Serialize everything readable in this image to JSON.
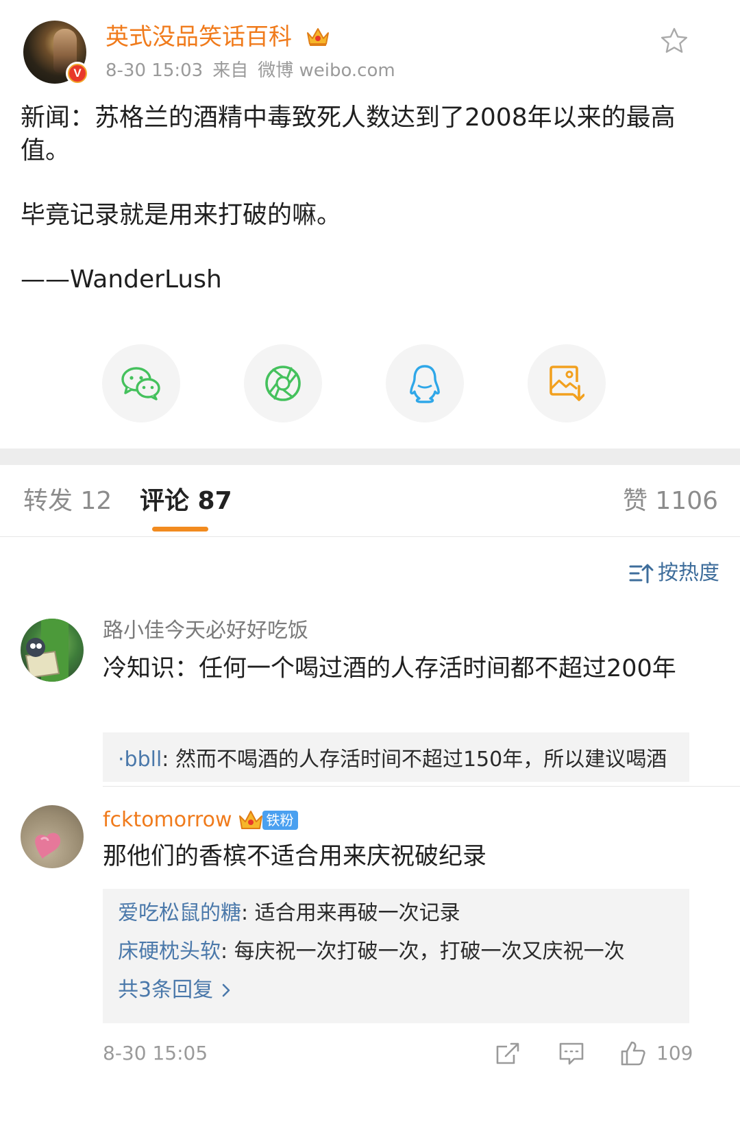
{
  "post": {
    "author": "英式没品笑话百科",
    "time": "8-30 15:03",
    "source_prefix": "来自",
    "source": "微博 weibo.com",
    "paragraphs": [
      "新闻：苏格兰的酒精中毒致死人数达到了2008年以来的最高值。",
      "毕竟记录就是用来打破的嘛。",
      "——WanderLush"
    ]
  },
  "share": {
    "items": [
      {
        "name": "wechat-share-button",
        "icon": "wechat-icon",
        "color": "#45c15d"
      },
      {
        "name": "moments-share-button",
        "icon": "moments-aperture-icon",
        "color": "#45c15d"
      },
      {
        "name": "qq-share-button",
        "icon": "qq-penguin-icon",
        "color": "#2fa7e8"
      },
      {
        "name": "save-image-button",
        "icon": "save-image-icon",
        "color": "#f2a01e"
      }
    ]
  },
  "tabs": {
    "repost": "转发 12",
    "comment": "评论 87",
    "like": "赞 1106",
    "accent": "#f28b1f"
  },
  "sort": {
    "label": "按热度"
  },
  "comments": [
    {
      "author": "路小佳今天必好好吃饭",
      "text": "冷知识：任何一个喝过酒的人存活时间都不超过200年",
      "replies": [
        {
          "user": "·bbll",
          "text": ": 然而不喝酒的人存活时间不超过150年，所以建议喝酒"
        }
      ]
    },
    {
      "author": "fcktomorrow",
      "badge": "铁粉",
      "text": "那他们的香槟不适合用来庆祝破纪录",
      "replies": [
        {
          "user": "爱吃松鼠的糖",
          "text": ": 适合用来再破一次记录"
        },
        {
          "user": "床硬枕头软",
          "text": ": 每庆祝一次打破一次，打破一次又庆祝一次"
        }
      ],
      "more_replies": "共3条回复",
      "time": "8-30 15:05",
      "like_count": "109"
    }
  ]
}
